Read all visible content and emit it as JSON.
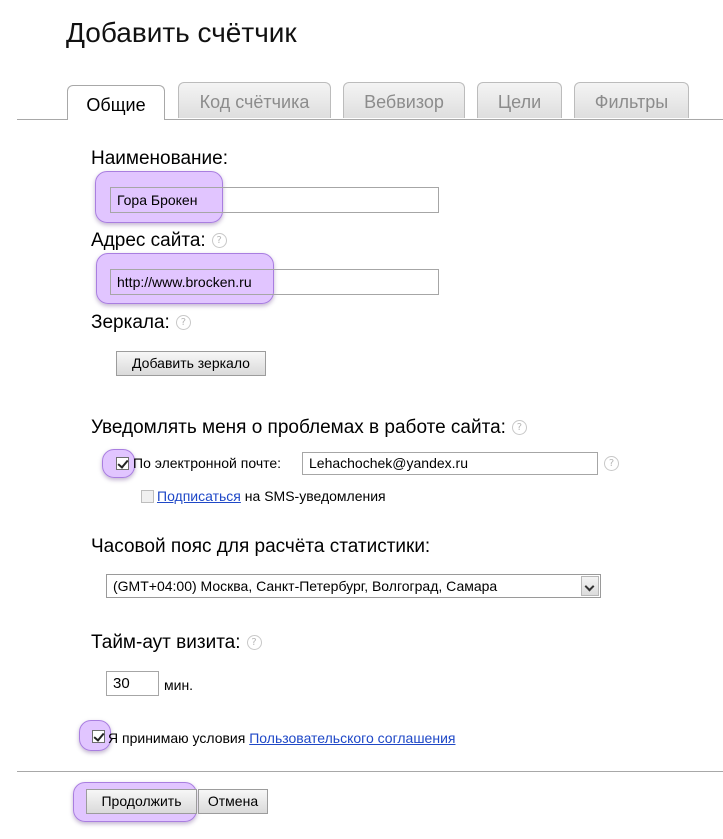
{
  "page": {
    "title": "Добавить счётчик"
  },
  "tabs": [
    {
      "label": "Общие",
      "active": true
    },
    {
      "label": "Код счётчика"
    },
    {
      "label": "Вебвизор"
    },
    {
      "label": "Цели"
    },
    {
      "label": "Фильтры"
    }
  ],
  "form": {
    "name_label": "Наименование:",
    "name_value": "Гора Брокен",
    "site_label": "Адрес сайта:",
    "site_value": "http://www.brocken.ru",
    "mirrors_label": "Зеркала:",
    "add_mirror_label": "Добавить зеркало",
    "notify_label": "Уведомлять меня о проблемах в работе сайта:",
    "email_checkbox_label": "По электронной почте:",
    "email_value": "Lehachochek@yandex.ru",
    "sms_link": "Подписаться",
    "sms_text": "на SMS-уведомления",
    "timezone_label": "Часовой пояс для расчёта статистики:",
    "timezone_value": "(GMT+04:00) Москва, Санкт-Петербург, Волгоград, Самара",
    "timeout_label": "Тайм-аут визита:",
    "timeout_value": "30",
    "timeout_unit": "мин.",
    "agree_text": "Я принимаю условия",
    "agree_link": "Пользовательского соглашения",
    "help_glyph": "?"
  },
  "actions": {
    "continue_label": "Продолжить",
    "cancel_label": "Отмена"
  },
  "colors": {
    "highlight": "#c896ff",
    "link": "#1f48c7"
  }
}
